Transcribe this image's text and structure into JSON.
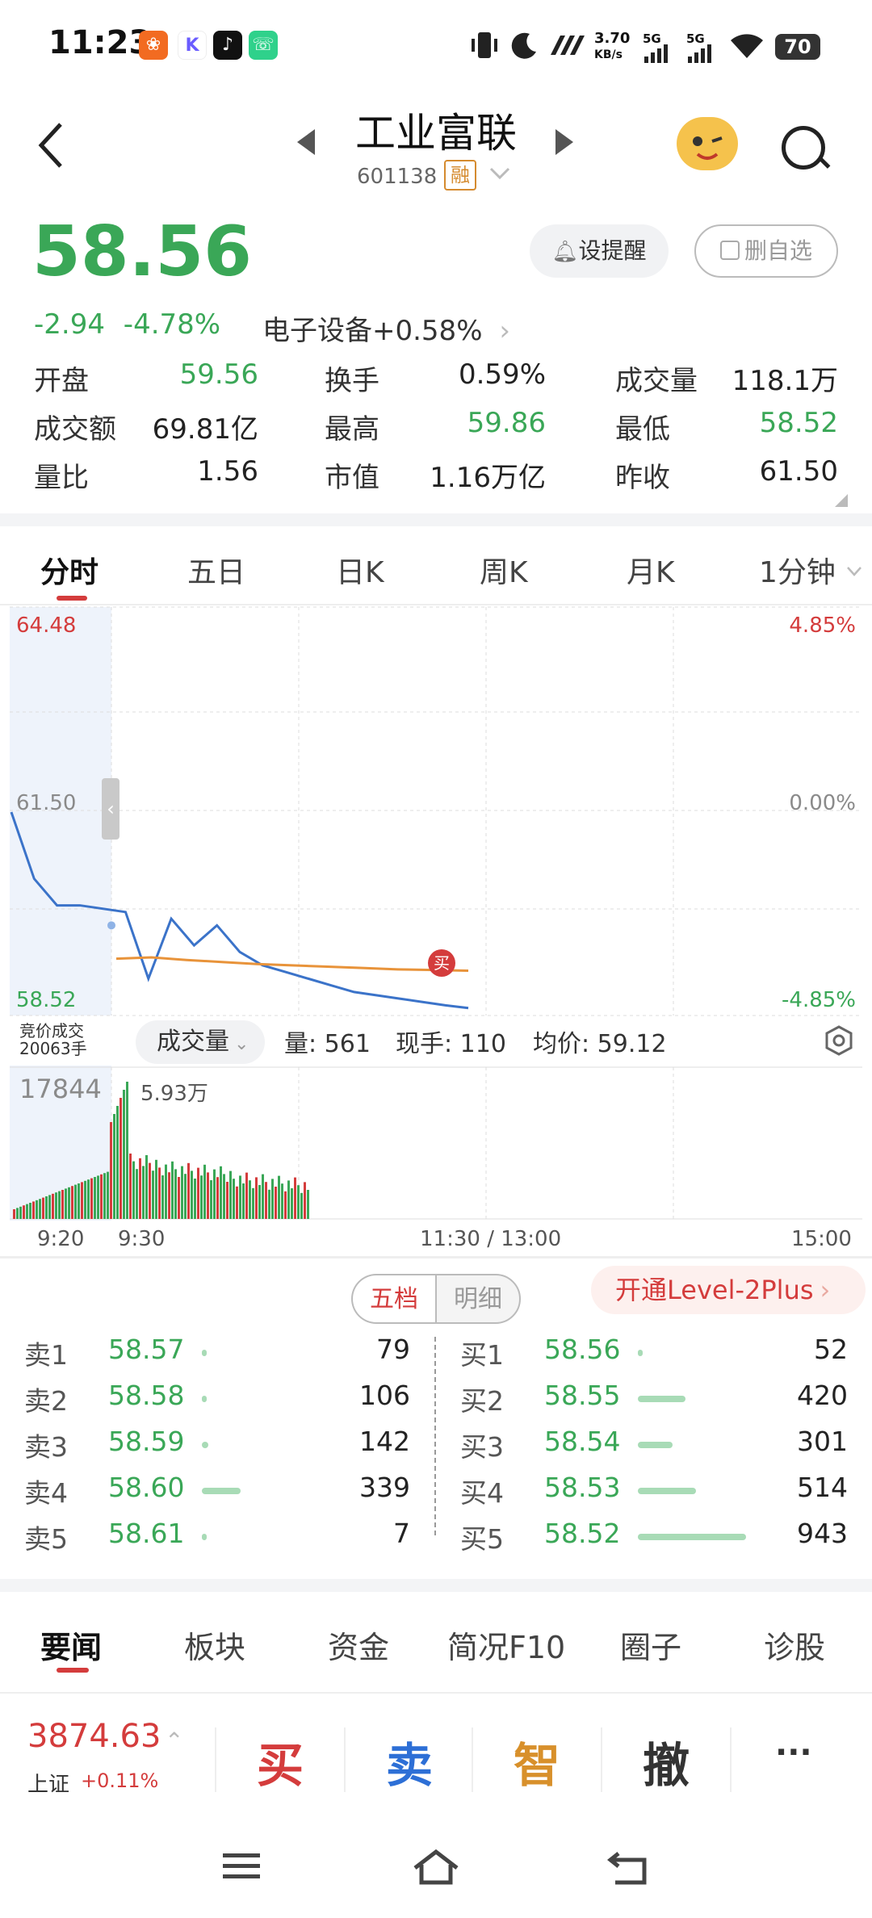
{
  "status_bar": {
    "time": "11:23",
    "net_speed_top": "3.70",
    "net_speed_bottom": "KB/s",
    "sig1": "5G",
    "sig2": "5G",
    "battery": "70"
  },
  "header": {
    "stock_name": "工业富联",
    "stock_code": "601138",
    "margin_badge": "融"
  },
  "quote": {
    "price": "58.56",
    "change": "-2.94",
    "change_pct": "-4.78%",
    "sector": "电子设备",
    "sector_change": "+0.58%",
    "alert_button": "设提醒",
    "remove_button": "删自选",
    "stats": [
      {
        "label": "开盘",
        "value": "59.56",
        "color": "#3aa757"
      },
      {
        "label": "换手",
        "value": "0.59%",
        "color": "#222222"
      },
      {
        "label": "成交量",
        "value": "118.1万",
        "color": "#222222"
      },
      {
        "label": "成交额",
        "value": "69.81亿",
        "color": "#222222"
      },
      {
        "label": "最高",
        "value": "59.86",
        "color": "#3aa757"
      },
      {
        "label": "最低",
        "value": "58.52",
        "color": "#3aa757"
      },
      {
        "label": "量比",
        "value": "1.56",
        "color": "#222222"
      },
      {
        "label": "市值",
        "value": "1.16万亿",
        "color": "#222222"
      },
      {
        "label": "昨收",
        "value": "61.50",
        "color": "#222222"
      }
    ]
  },
  "chart_tabs": [
    "分时",
    "五日",
    "日K",
    "周K",
    "月K",
    "1分钟"
  ],
  "chart": {
    "y_top": "64.48",
    "y_mid": "61.50",
    "y_bottom": "58.52",
    "pct_top": "4.85%",
    "pct_mid": "0.00%",
    "pct_bottom": "-4.85%",
    "buy_marker": "买",
    "auction_label_1": "竞价成交",
    "auction_label_2": "20063手",
    "volume_selector": "成交量",
    "volume_info": "量: 561",
    "current_hand": "现手: 110",
    "avg_price": "均价: 59.12",
    "vol_max_left": "17844",
    "vol_max_right": "5.93万",
    "x_labels": [
      "9:20",
      "9:30",
      "11:30 / 13:00",
      "15:00"
    ]
  },
  "chart_data": {
    "type": "line",
    "title": "",
    "ylim": [
      58.52,
      64.48
    ],
    "y_ticks": [
      "64.48",
      "61.50",
      "58.52"
    ],
    "series": [
      {
        "values": [
          61.5,
          60.5,
          60.1,
          60.1,
          60.05,
          60.0,
          59.0,
          59.9,
          59.5,
          59.8,
          59.4,
          59.2,
          59.1,
          59.0,
          58.9,
          58.8,
          58.75,
          58.7,
          58.65,
          58.6,
          58.56
        ]
      },
      {
        "values": [
          59.3,
          59.32,
          59.28,
          59.25,
          59.22,
          59.2,
          59.18,
          59.16,
          59.14,
          59.13,
          59.12
        ]
      }
    ],
    "volume": {
      "max_label": "5.93万"
    }
  },
  "depth": {
    "tab_wudang": "五档",
    "tab_mingxi": "明细",
    "level2": "开通Level-2Plus",
    "sell": [
      {
        "label": "卖1",
        "price": "58.57",
        "vol": "79",
        "bar": 0.02
      },
      {
        "label": "卖2",
        "price": "58.58",
        "vol": "106",
        "bar": 0.04
      },
      {
        "label": "卖3",
        "price": "58.59",
        "vol": "142",
        "bar": 0.06
      },
      {
        "label": "卖4",
        "price": "58.60",
        "vol": "339",
        "bar": 0.36
      },
      {
        "label": "卖5",
        "price": "58.61",
        "vol": "7",
        "bar": 0.01
      }
    ],
    "buy": [
      {
        "label": "买1",
        "price": "58.56",
        "vol": "52",
        "bar": 0.02
      },
      {
        "label": "买2",
        "price": "58.55",
        "vol": "420",
        "bar": 0.44
      },
      {
        "label": "买3",
        "price": "58.54",
        "vol": "301",
        "bar": 0.32
      },
      {
        "label": "买4",
        "price": "58.53",
        "vol": "514",
        "bar": 0.54
      },
      {
        "label": "买5",
        "price": "58.52",
        "vol": "943",
        "bar": 1.0
      }
    ]
  },
  "bottom_tabs": [
    "要闻",
    "板块",
    "资金",
    "简况F10",
    "圈子",
    "诊股"
  ],
  "action_bar": {
    "index_value": "3874.63",
    "index_name": "上证",
    "index_change": "+0.11%",
    "buy": "买",
    "sell": "卖",
    "smart": "智",
    "cancel": "撤",
    "more": "···"
  }
}
